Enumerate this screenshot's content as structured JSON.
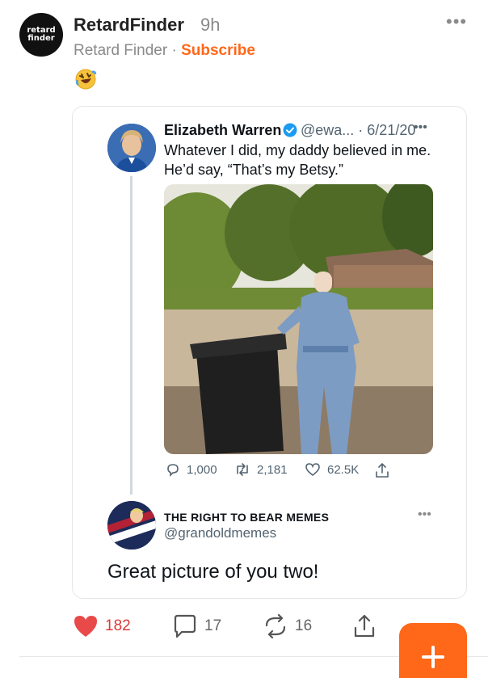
{
  "post": {
    "logo_line1": "retard",
    "logo_line2": "finder",
    "author": "RetardFinder",
    "time": "9h",
    "more": "•••",
    "publication": "Retard Finder",
    "separator": "·",
    "subscribe": "Subscribe",
    "emoji": "rolling-on-the-floor-laughing"
  },
  "tweet": {
    "name": "Elizabeth Warren",
    "handle": "@ewa... · 6/21/20",
    "more": "•••",
    "text_line1": "Whatever I did, my daddy believed in me.",
    "text_line2": "He’d say, “That’s my Betsy.”",
    "stats": {
      "replies": "1,000",
      "retweets": "2,181",
      "likes": "62.5K"
    }
  },
  "reply": {
    "name": "THE RIGHT TO BEAR MEMES",
    "handle": "@grandoldmemes",
    "more": "•••",
    "avatar_label": "YUGE",
    "text": "Great picture of you two!"
  },
  "actions": {
    "likes": "182",
    "comments": "17",
    "restacks": "16"
  },
  "colors": {
    "accent": "#ff6719",
    "like": "#d93a3a",
    "verified": "#1d9bf0"
  }
}
